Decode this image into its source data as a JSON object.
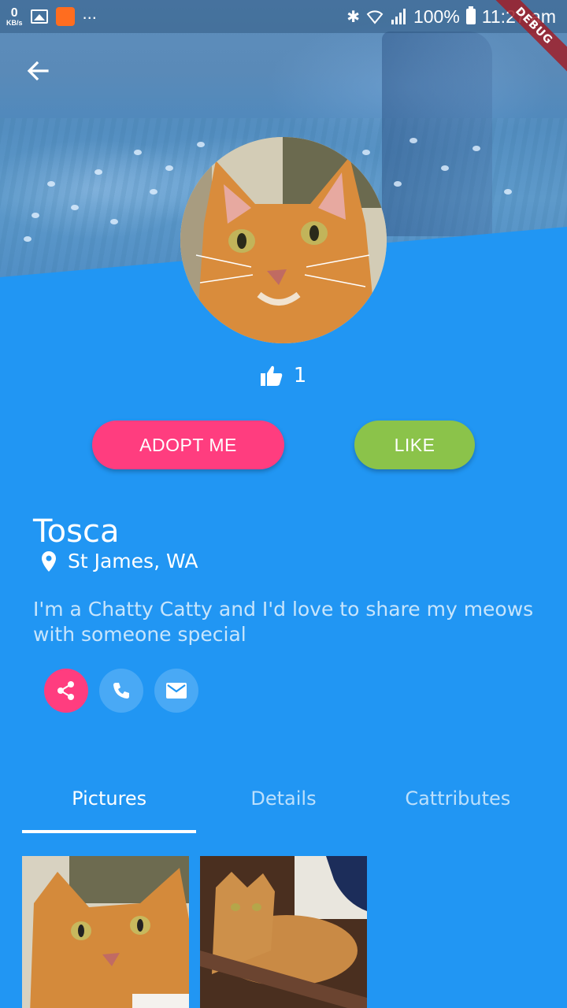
{
  "status_bar": {
    "speed_value": "0",
    "speed_unit": "KB/s",
    "more": "...",
    "battery": "100%",
    "time": "11:27 am"
  },
  "debug_banner": "DEBUG",
  "pet": {
    "likes": "1",
    "name": "Tosca",
    "location": "St James, WA",
    "description": "I'm a Chatty Catty and I'd love to share my meows with someone special"
  },
  "actions": {
    "adopt_label": "ADOPT ME",
    "like_label": "LIKE"
  },
  "tabs": [
    {
      "label": "Pictures",
      "active": true
    },
    {
      "label": "Details",
      "active": false
    },
    {
      "label": "Cattributes",
      "active": false
    }
  ],
  "colors": {
    "primary": "#2196F3",
    "adopt": "#FF3D7F",
    "like": "#8BC34A",
    "share": "#FF3D7F"
  },
  "icons": [
    "back-arrow-icon",
    "thumbs-up-icon",
    "location-pin-icon",
    "share-icon",
    "phone-icon",
    "mail-icon"
  ]
}
